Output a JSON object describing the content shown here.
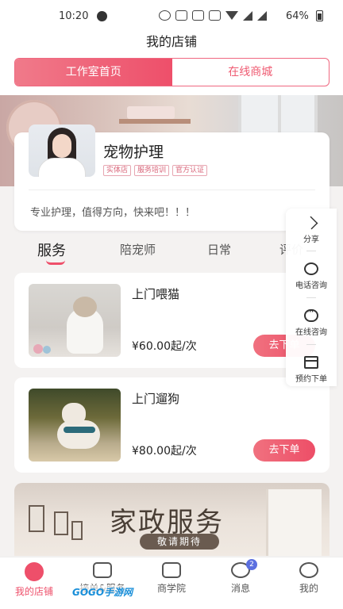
{
  "status_bar": {
    "time": "10:20",
    "battery": "64%"
  },
  "header": {
    "title": "我的店铺"
  },
  "top_tabs": [
    {
      "label": "工作室首页",
      "active": true
    },
    {
      "label": "在线商城",
      "active": false
    }
  ],
  "shop": {
    "name": "宠物护理",
    "tags": [
      "实体店",
      "服务培训",
      "官方认证"
    ],
    "description": "专业护理，值得方向，快来吧！！！"
  },
  "sub_tabs": [
    {
      "label": "服务",
      "active": true
    },
    {
      "label": "陪宠师",
      "active": false
    },
    {
      "label": "日常",
      "active": false
    },
    {
      "label": "评价",
      "active": false
    }
  ],
  "services": [
    {
      "title": "上门喂猫",
      "price": "¥60.00起/次",
      "button": "去下单",
      "image": "cat-photo"
    },
    {
      "title": "上门遛狗",
      "price": "¥80.00起/次",
      "button": "去下单",
      "image": "dog-photo"
    }
  ],
  "promo": {
    "title": "家政服务",
    "subtitle": "敬请期待"
  },
  "float_panel": [
    {
      "label": "分享",
      "icon": "share-icon"
    },
    {
      "label": "电话咨询",
      "icon": "phone-icon"
    },
    {
      "label": "在线咨询",
      "icon": "chat-icon"
    },
    {
      "label": "预约下单",
      "icon": "calendar-icon"
    }
  ],
  "bottom_nav": [
    {
      "label": "我的店铺",
      "icon": "store-icon",
      "active": true
    },
    {
      "label": "接单&服务",
      "icon": "chart-icon",
      "active": false
    },
    {
      "label": "商学院",
      "icon": "book-icon",
      "active": false
    },
    {
      "label": "消息",
      "icon": "message-icon",
      "active": false,
      "badge": "2"
    },
    {
      "label": "我的",
      "icon": "profile-icon",
      "active": false
    }
  ],
  "watermark": "GOGO手游网",
  "colors": {
    "accent": "#ee4f6a",
    "badge": "#5b6fe0"
  }
}
